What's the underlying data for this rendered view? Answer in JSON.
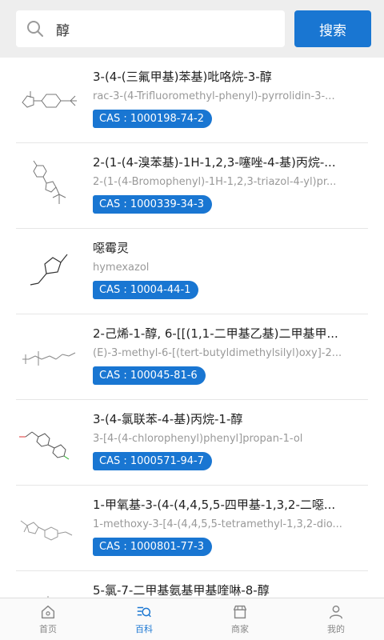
{
  "search": {
    "value": "醇",
    "button_label": "搜索"
  },
  "results": [
    {
      "name": "3-(4-(三氟甲基)苯基)吡咯烷-3-醇",
      "en": "rac-3-(4-Trifluoromethyl-phenyl)-pyrrolidin-3-...",
      "cas": "CAS : 1000198-74-2"
    },
    {
      "name": "2-(1-(4-溴苯基)-1H-1,2,3-噻唑-4-基)丙烷-...",
      "en": "2-(1-(4-Bromophenyl)-1H-1,2,3-triazol-4-yl)pr...",
      "cas": "CAS : 1000339-34-3"
    },
    {
      "name": "噁霉灵",
      "en": "hymexazol",
      "cas": "CAS : 10004-44-1"
    },
    {
      "name": "2-己烯-1-醇, 6-[[(1,1-二甲基乙基)二甲基甲...",
      "en": "(E)-3-methyl-6-[(tert-butyldimethylsilyl)oxy]-2...",
      "cas": "CAS : 100045-81-6"
    },
    {
      "name": "3-(4-氯联苯-4-基)丙烷-1-醇",
      "en": "3-[4-(4-chlorophenyl)phenyl]propan-1-ol",
      "cas": "CAS : 1000571-94-7"
    },
    {
      "name": "1-甲氧基-3-(4-(4,4,5,5-四甲基-1,3,2-二噁...",
      "en": "1-methoxy-3-[4-(4,4,5,5-tetramethyl-1,3,2-dio...",
      "cas": "CAS : 1000801-77-3"
    },
    {
      "name": "5-氯-7-二甲基氨基甲基喹啉-8-醇",
      "en": "",
      "cas": ""
    }
  ],
  "tabs": [
    {
      "label": "首页",
      "icon": "home-icon"
    },
    {
      "label": "百科",
      "icon": "encyclopedia-icon"
    },
    {
      "label": "商家",
      "icon": "store-icon"
    },
    {
      "label": "我的",
      "icon": "user-icon"
    }
  ],
  "colors": {
    "accent": "#1976d2"
  }
}
